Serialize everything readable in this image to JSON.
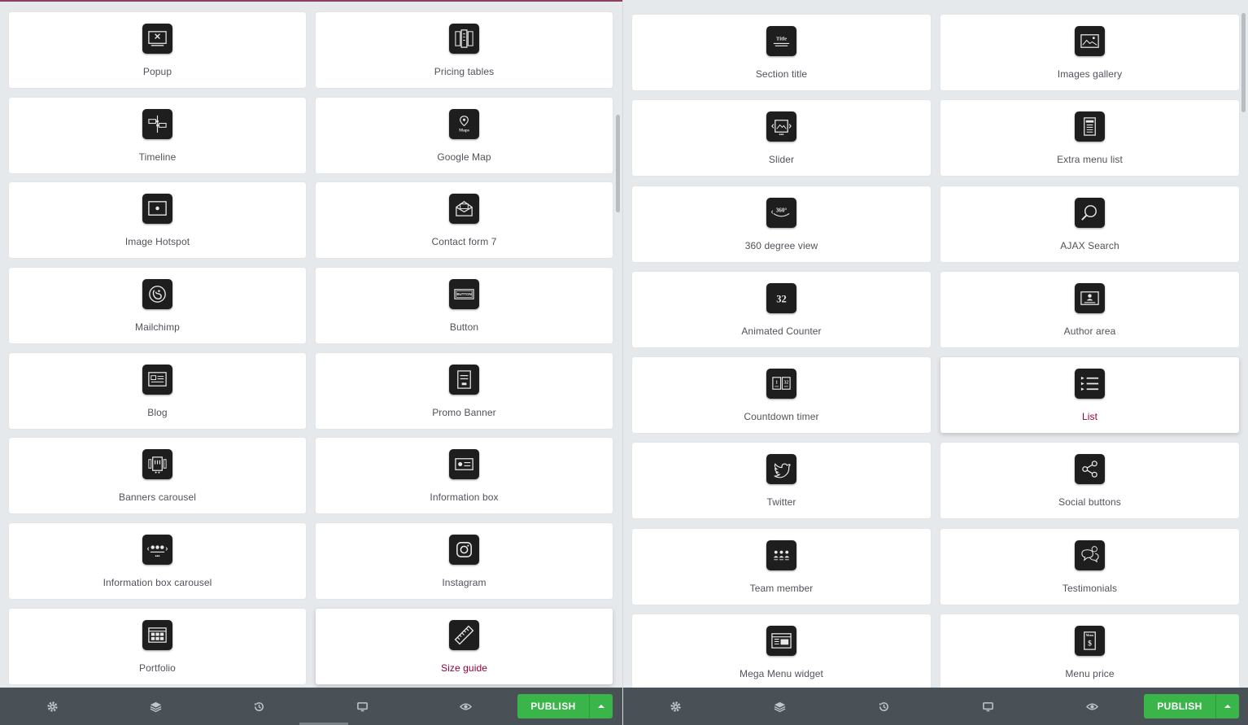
{
  "colors": {
    "accent": "#93003c",
    "publish": "#39b54a",
    "footer": "#495157",
    "icon_bg": "#1e1e1e"
  },
  "left_panel": {
    "widgets": [
      {
        "label": "Popup",
        "icon": "popup-icon"
      },
      {
        "label": "Pricing tables",
        "icon": "pricing-tables-icon"
      },
      {
        "label": "Timeline",
        "icon": "timeline-icon"
      },
      {
        "label": "Google Map",
        "icon": "google-map-icon"
      },
      {
        "label": "Image Hotspot",
        "icon": "image-hotspot-icon"
      },
      {
        "label": "Contact form 7",
        "icon": "contact-form-icon"
      },
      {
        "label": "Mailchimp",
        "icon": "mailchimp-icon"
      },
      {
        "label": "Button",
        "icon": "button-icon"
      },
      {
        "label": "Blog",
        "icon": "blog-icon"
      },
      {
        "label": "Promo Banner",
        "icon": "promo-banner-icon"
      },
      {
        "label": "Banners carousel",
        "icon": "banners-carousel-icon"
      },
      {
        "label": "Information box",
        "icon": "information-box-icon"
      },
      {
        "label": "Information box carousel",
        "icon": "information-box-carousel-icon"
      },
      {
        "label": "Instagram",
        "icon": "instagram-icon"
      },
      {
        "label": "Portfolio",
        "icon": "portfolio-icon"
      },
      {
        "label": "Size guide",
        "icon": "size-guide-icon",
        "active": true
      }
    ],
    "footer": {
      "tools": [
        "settings-icon",
        "layers-icon",
        "history-icon",
        "responsive-icon",
        "preview-icon"
      ],
      "publish_label": "PUBLISH"
    }
  },
  "right_panel": {
    "widgets": [
      {
        "label": "Section title",
        "icon": "section-title-icon"
      },
      {
        "label": "Images gallery",
        "icon": "images-gallery-icon"
      },
      {
        "label": "Slider",
        "icon": "slider-icon"
      },
      {
        "label": "Extra menu list",
        "icon": "extra-menu-list-icon"
      },
      {
        "label": "360 degree view",
        "icon": "360-degree-view-icon"
      },
      {
        "label": "AJAX Search",
        "icon": "ajax-search-icon"
      },
      {
        "label": "Animated Counter",
        "icon": "animated-counter-icon"
      },
      {
        "label": "Author area",
        "icon": "author-area-icon"
      },
      {
        "label": "Countdown timer",
        "icon": "countdown-timer-icon"
      },
      {
        "label": "List",
        "icon": "list-icon",
        "active": true
      },
      {
        "label": "Twitter",
        "icon": "twitter-icon"
      },
      {
        "label": "Social buttons",
        "icon": "social-buttons-icon"
      },
      {
        "label": "Team member",
        "icon": "team-member-icon"
      },
      {
        "label": "Testimonials",
        "icon": "testimonials-icon"
      },
      {
        "label": "Mega Menu widget",
        "icon": "mega-menu-widget-icon"
      },
      {
        "label": "Menu price",
        "icon": "menu-price-icon"
      }
    ],
    "footer": {
      "tools": [
        "settings-icon",
        "layers-icon",
        "history-icon",
        "responsive-icon",
        "preview-icon"
      ],
      "publish_label": "PUBLISH"
    }
  },
  "icon_text": {
    "section_title": "Title",
    "view_360": "360°",
    "counter": "32",
    "map": "Maps",
    "button": "BUTTON",
    "countdown_days": "1",
    "countdown_mins": "32",
    "menu": "Menu",
    "price": "$"
  }
}
